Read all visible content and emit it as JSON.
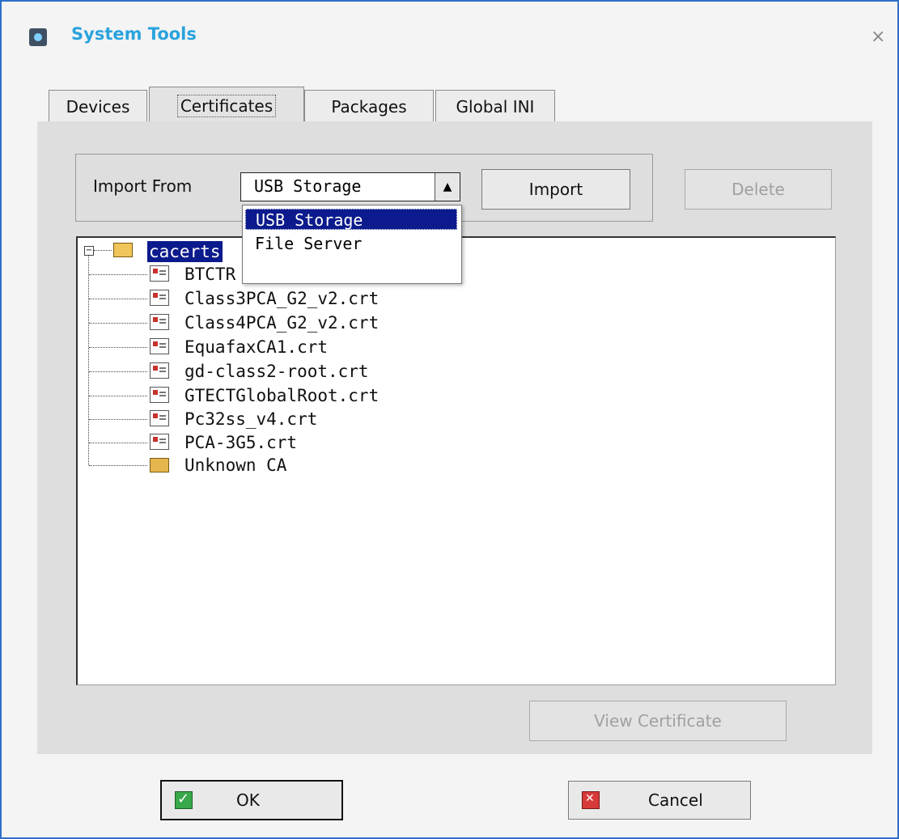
{
  "window": {
    "title": "System Tools",
    "close": "×"
  },
  "tabs": [
    {
      "label": "Devices"
    },
    {
      "label": "Certificates"
    },
    {
      "label": "Packages"
    },
    {
      "label": "Global INI"
    }
  ],
  "import_group": {
    "label": "Import From",
    "combo_value": "USB Storage",
    "combo_arrow": "▲",
    "import_button": "Import",
    "delete_button": "Delete"
  },
  "dropdown": {
    "options": [
      "USB Storage",
      "File Server"
    ]
  },
  "tree": {
    "root": "cacerts",
    "items": [
      "BTCTR",
      "Class3PCA_G2_v2.crt",
      "Class4PCA_G2_v2.crt",
      "EquafaxCA1.crt",
      "gd-class2-root.crt",
      "GTECTGlobalRoot.crt",
      "Pc32ss_v4.crt",
      "PCA-3G5.crt"
    ],
    "folder": "Unknown CA"
  },
  "buttons": {
    "view_certificate": "View Certificate",
    "ok": "OK",
    "cancel": "Cancel"
  },
  "colors": {
    "accent": "#2aa3dd",
    "selection": "#0b1a8c",
    "frame": "#2f6fc9"
  }
}
